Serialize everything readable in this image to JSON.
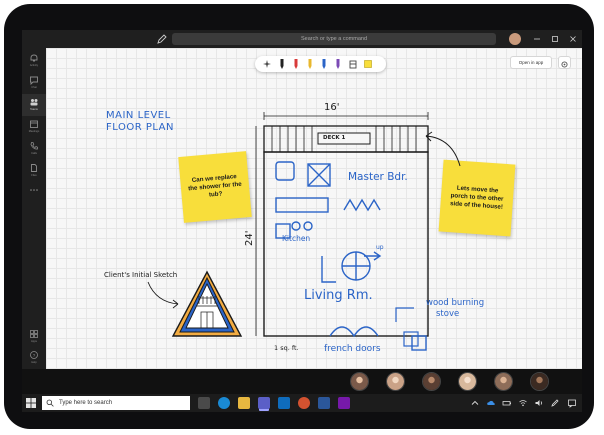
{
  "titlebar": {
    "search_placeholder": "Search or type a command"
  },
  "rail": {
    "items": [
      {
        "label": "Activity",
        "icon": "bell-icon"
      },
      {
        "label": "Chat",
        "icon": "chat-icon"
      },
      {
        "label": "Teams",
        "icon": "teams-icon",
        "active": true
      },
      {
        "label": "Meetings",
        "icon": "calendar-icon"
      },
      {
        "label": "Calls",
        "icon": "phone-icon"
      },
      {
        "label": "Files",
        "icon": "file-icon"
      },
      {
        "label": "",
        "icon": "more-icon"
      },
      {
        "label": "Apps",
        "icon": "apps-icon"
      },
      {
        "label": "Help",
        "icon": "help-icon"
      }
    ]
  },
  "board": {
    "open_in_app_label": "Open in app",
    "toolbar_tools": [
      "lasso-icon",
      "pen-black",
      "pen-red",
      "pen-yellow",
      "pen-blue",
      "pen-purple",
      "eraser-icon",
      "sticky-note-icon"
    ],
    "colors": {
      "ink_blue": "#2b64c7",
      "sticky_yellow": "#f8de3b",
      "accent": "#5b5fc7"
    },
    "handwriting": {
      "title_line1": "MAIN LEVEL",
      "title_line2": "FLOOR PLAN",
      "width_dim": "16'",
      "height_dim": "24'",
      "deck_label": "DECK 1",
      "master_bdr": "Master Bdr.",
      "kitchen": "Kitchen",
      "up": "up",
      "living_rm": "Living Rm.",
      "wood_stove_line1": "wood burning",
      "wood_stove_line2": "stove",
      "french_doors": "french doors",
      "sq_ft": "1 sq. ft.",
      "clients_sketch": "Client's Initial Sketch"
    },
    "sticky_notes": [
      {
        "text": "Can we replace the shower for the tub?"
      },
      {
        "text": "Lets move the porch to the other side of the house!"
      }
    ]
  },
  "call": {
    "participants": [
      "participant-1",
      "participant-2",
      "participant-3",
      "participant-4",
      "participant-5",
      "participant-6"
    ],
    "avatar_colors": [
      "#7b5a4a",
      "#caa287",
      "#5a3f33",
      "#d8b89c",
      "#8e6d59",
      "#3b2a22"
    ]
  },
  "taskbar": {
    "search_placeholder": "Type here to search",
    "apps": [
      "task-view-icon",
      "edge-icon",
      "file-explorer-icon",
      "teams-icon",
      "outlook-icon",
      "powerpoint-icon",
      "word-icon",
      "onenote-icon"
    ],
    "app_colors": [
      "#4a4a4a",
      "#1a8ad4",
      "#e8b840",
      "#5b5fc7",
      "#0f6cbd",
      "#d35230",
      "#2b579a",
      "#7719aa"
    ]
  }
}
